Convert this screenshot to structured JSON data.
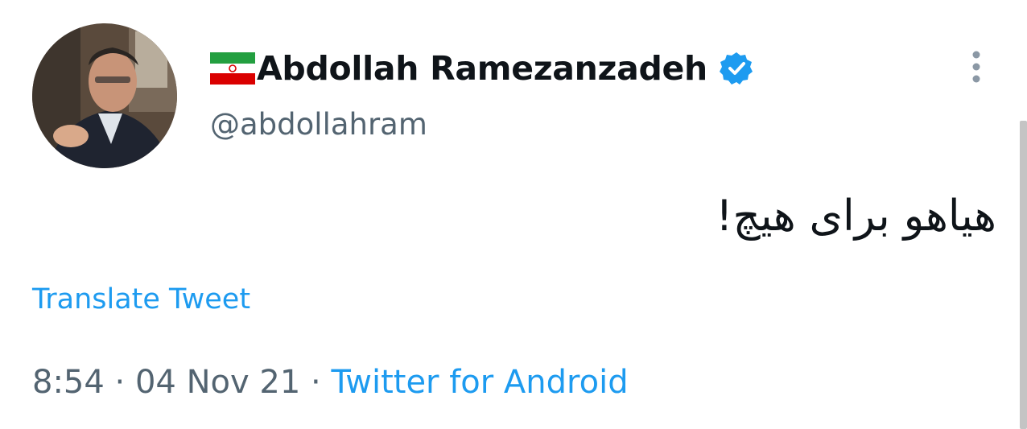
{
  "user": {
    "display_name": "Abdollah Ramezanzadeh",
    "handle": "@abdollahram",
    "verified": true,
    "flag_icon": "iran-flag-icon",
    "verified_icon": "verified-badge-icon"
  },
  "tweet": {
    "text": "هیاهو برای هیچ!",
    "translate_label": "Translate Tweet"
  },
  "meta": {
    "time": "8:54",
    "separator": "·",
    "date": "04 Nov 21",
    "source": "Twitter for Android"
  },
  "icons": {
    "more": "more-options-icon",
    "avatar": "profile-photo"
  },
  "colors": {
    "link": "#1d9bf0",
    "secondary_text": "#536471",
    "primary_text": "#0f1419",
    "verified": "#1d9bf0"
  }
}
